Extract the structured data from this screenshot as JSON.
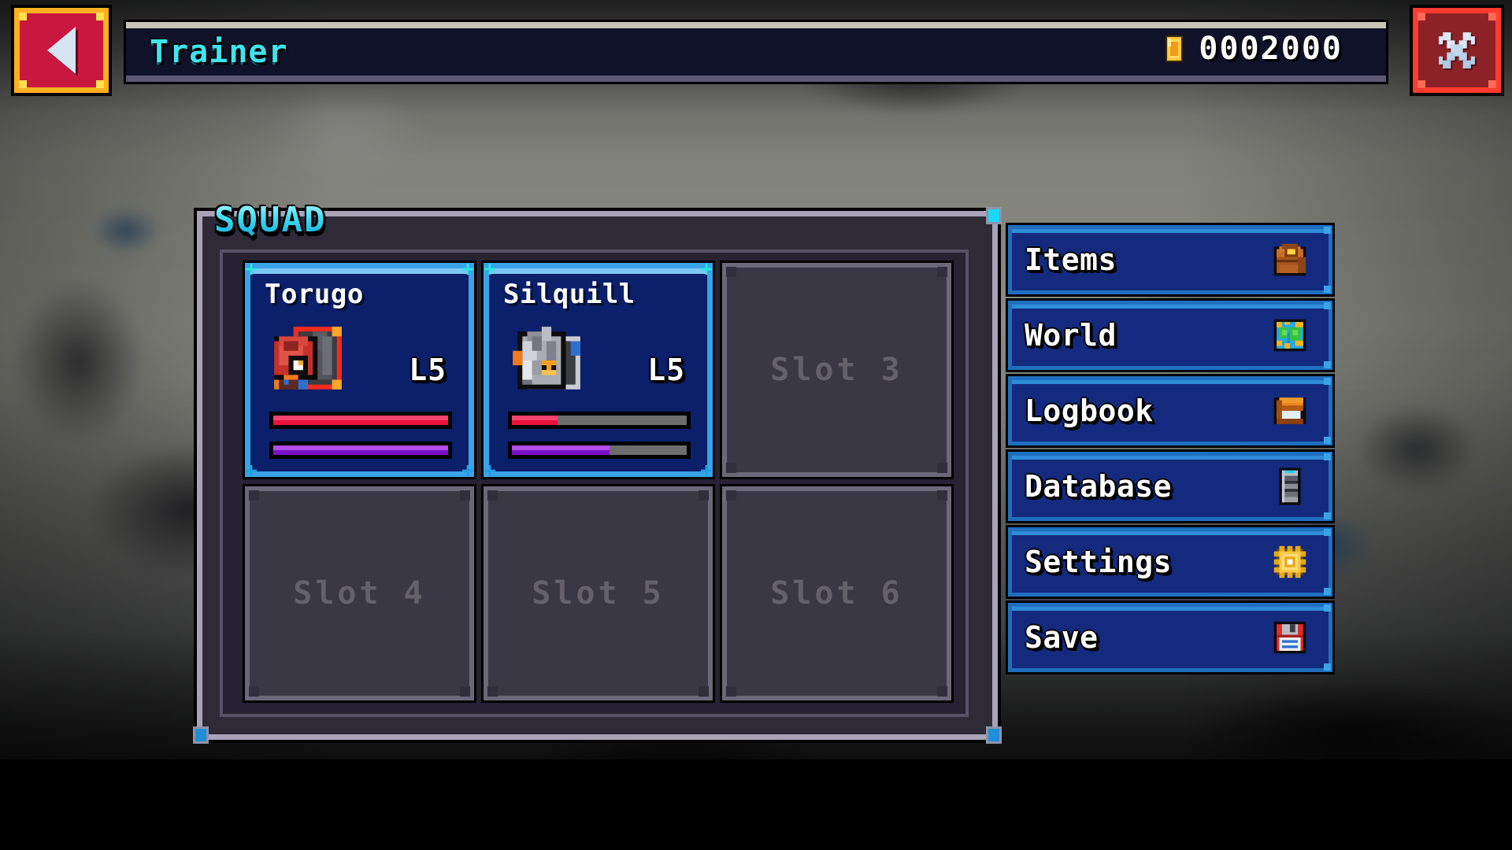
{
  "window": {
    "title": "Trainer"
  },
  "topbar": {
    "title": "Trainer",
    "back_icon": "left-triangle-icon",
    "close_icon": "x-cross-icon",
    "currency": {
      "icon": "gold-coin-icon",
      "value": "0002000"
    }
  },
  "squad": {
    "title": "SQUAD",
    "slots": [
      {
        "index": 1,
        "filled": true,
        "name": "Torugo",
        "level": "L5",
        "sprite": "red-shell-creature-sprite",
        "hp_percent": 100,
        "xp_percent": 100
      },
      {
        "index": 2,
        "filled": true,
        "name": "Silquill",
        "level": "L5",
        "sprite": "gray-quill-creature-sprite",
        "hp_percent": 26,
        "xp_percent": 56
      },
      {
        "index": 3,
        "filled": false,
        "label": "Slot 3"
      },
      {
        "index": 4,
        "filled": false,
        "label": "Slot 4"
      },
      {
        "index": 5,
        "filled": false,
        "label": "Slot 5"
      },
      {
        "index": 6,
        "filled": false,
        "label": "Slot 6"
      }
    ]
  },
  "menu": {
    "items": [
      {
        "label": "Items",
        "icon": "brown-bag-icon"
      },
      {
        "label": "World",
        "icon": "world-map-icon"
      },
      {
        "label": "Logbook",
        "icon": "orange-book-icon"
      },
      {
        "label": "Database",
        "icon": "server-stack-icon"
      },
      {
        "label": "Settings",
        "icon": "gold-gear-icon"
      },
      {
        "label": "Save",
        "icon": "red-floppy-disk-icon"
      }
    ]
  },
  "colors": {
    "accent_cyan": "#3fe4ef",
    "panel_blue": "#132a7e",
    "card_border": "#3aa3e8",
    "hp_red": "#e8123a",
    "hp_red_light": "#f5456e",
    "xp_purple": "#7a12c9",
    "xp_purple_light": "#b44ce8",
    "bar_empty": "#6d6d6d",
    "coin_gold": "#f5a623",
    "back_red": "#c9173f",
    "back_yellow": "#ffb020",
    "close_red": "#ff3a2e",
    "panel_border": "#a9a3b8",
    "panel_fill": "#2e2a38",
    "empty_slot_fill": "#3a3844",
    "empty_slot_text": "#64616d"
  }
}
